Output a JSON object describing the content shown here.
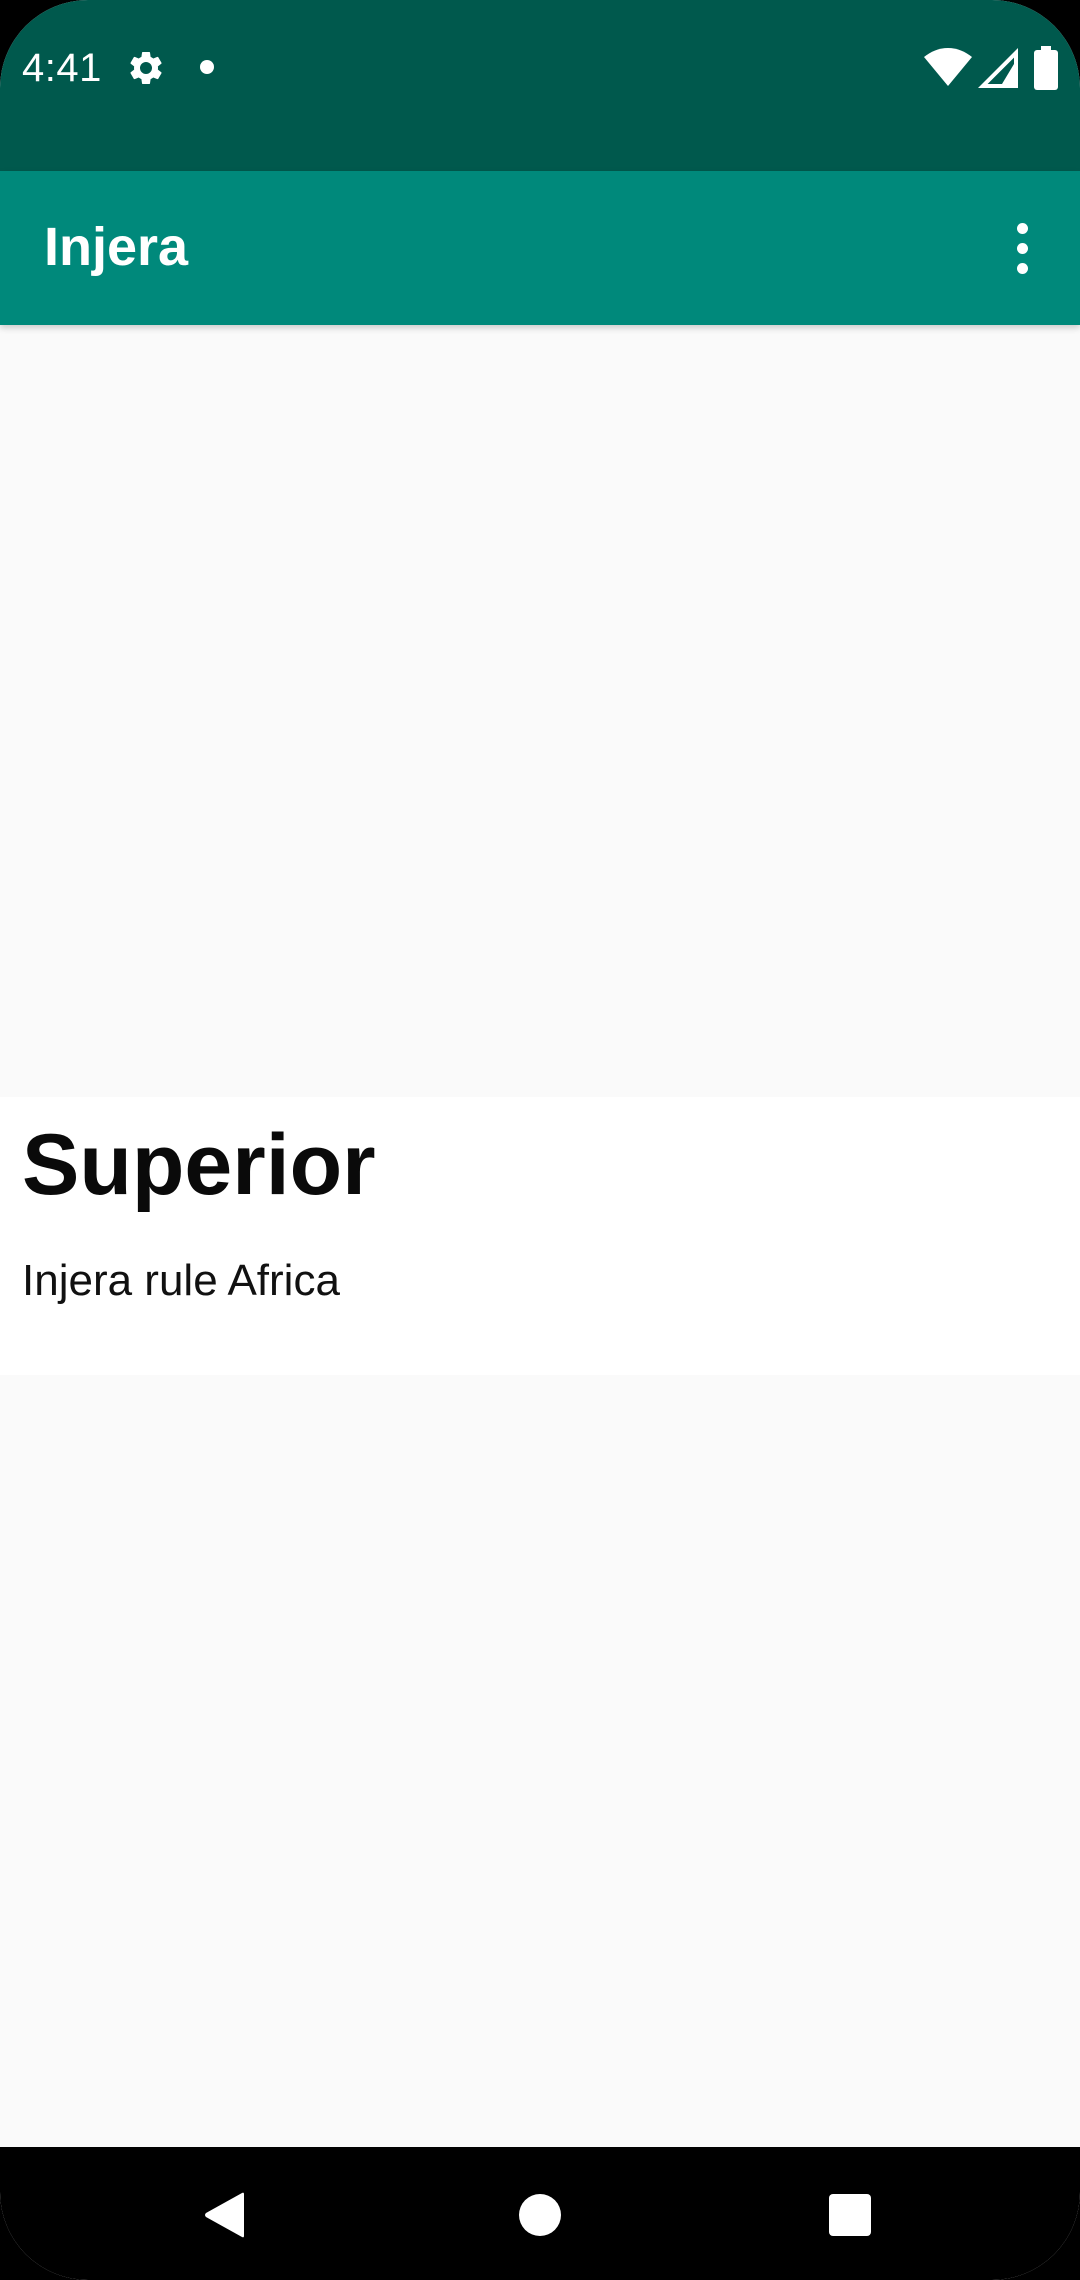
{
  "status_bar": {
    "time": "4:41",
    "icons": [
      "gear-icon",
      "notification-dot-icon",
      "wifi-icon",
      "signal-icon",
      "battery-icon"
    ]
  },
  "app_bar": {
    "title": "Injera",
    "overflow_icon": "more-vert-icon"
  },
  "card": {
    "title": "Superior",
    "text": "Injera rule Africa"
  },
  "nav_bar": {
    "icons": [
      "back-icon",
      "home-icon",
      "recents-icon"
    ]
  },
  "colors": {
    "status_bar": "#00594d",
    "app_bar": "#00897b",
    "background": "#fafafa",
    "card": "#ffffff",
    "nav_bar": "#000000"
  }
}
